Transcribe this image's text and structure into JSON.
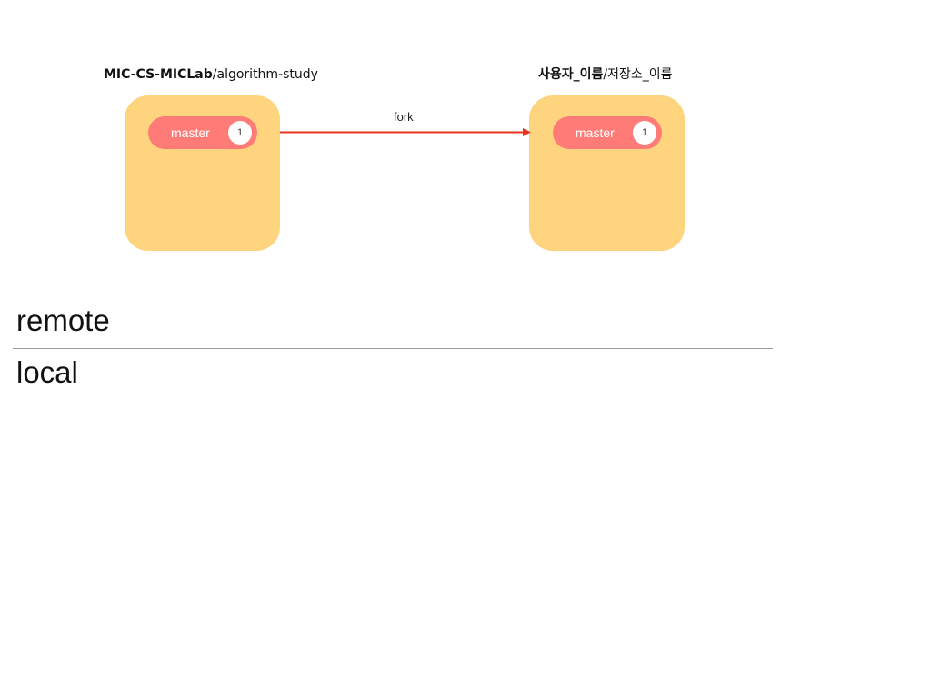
{
  "origin_repo": {
    "owner": "MIC-CS-MICLab",
    "separator": "/",
    "name": "algorithm-study",
    "branch": {
      "label": "master",
      "commit_count": "1"
    }
  },
  "fork_repo": {
    "owner": "사용자_이름",
    "separator": "/",
    "name": "저장소_이름",
    "branch": {
      "label": "master",
      "commit_count": "1"
    }
  },
  "arrow": {
    "label": "fork",
    "color": "#e8341c"
  },
  "zones": {
    "remote": "remote",
    "local": "local"
  },
  "colors": {
    "repo_box": "#ffd47e",
    "branch_pill": "#ff7b77",
    "divider": "#9a9a9a"
  }
}
